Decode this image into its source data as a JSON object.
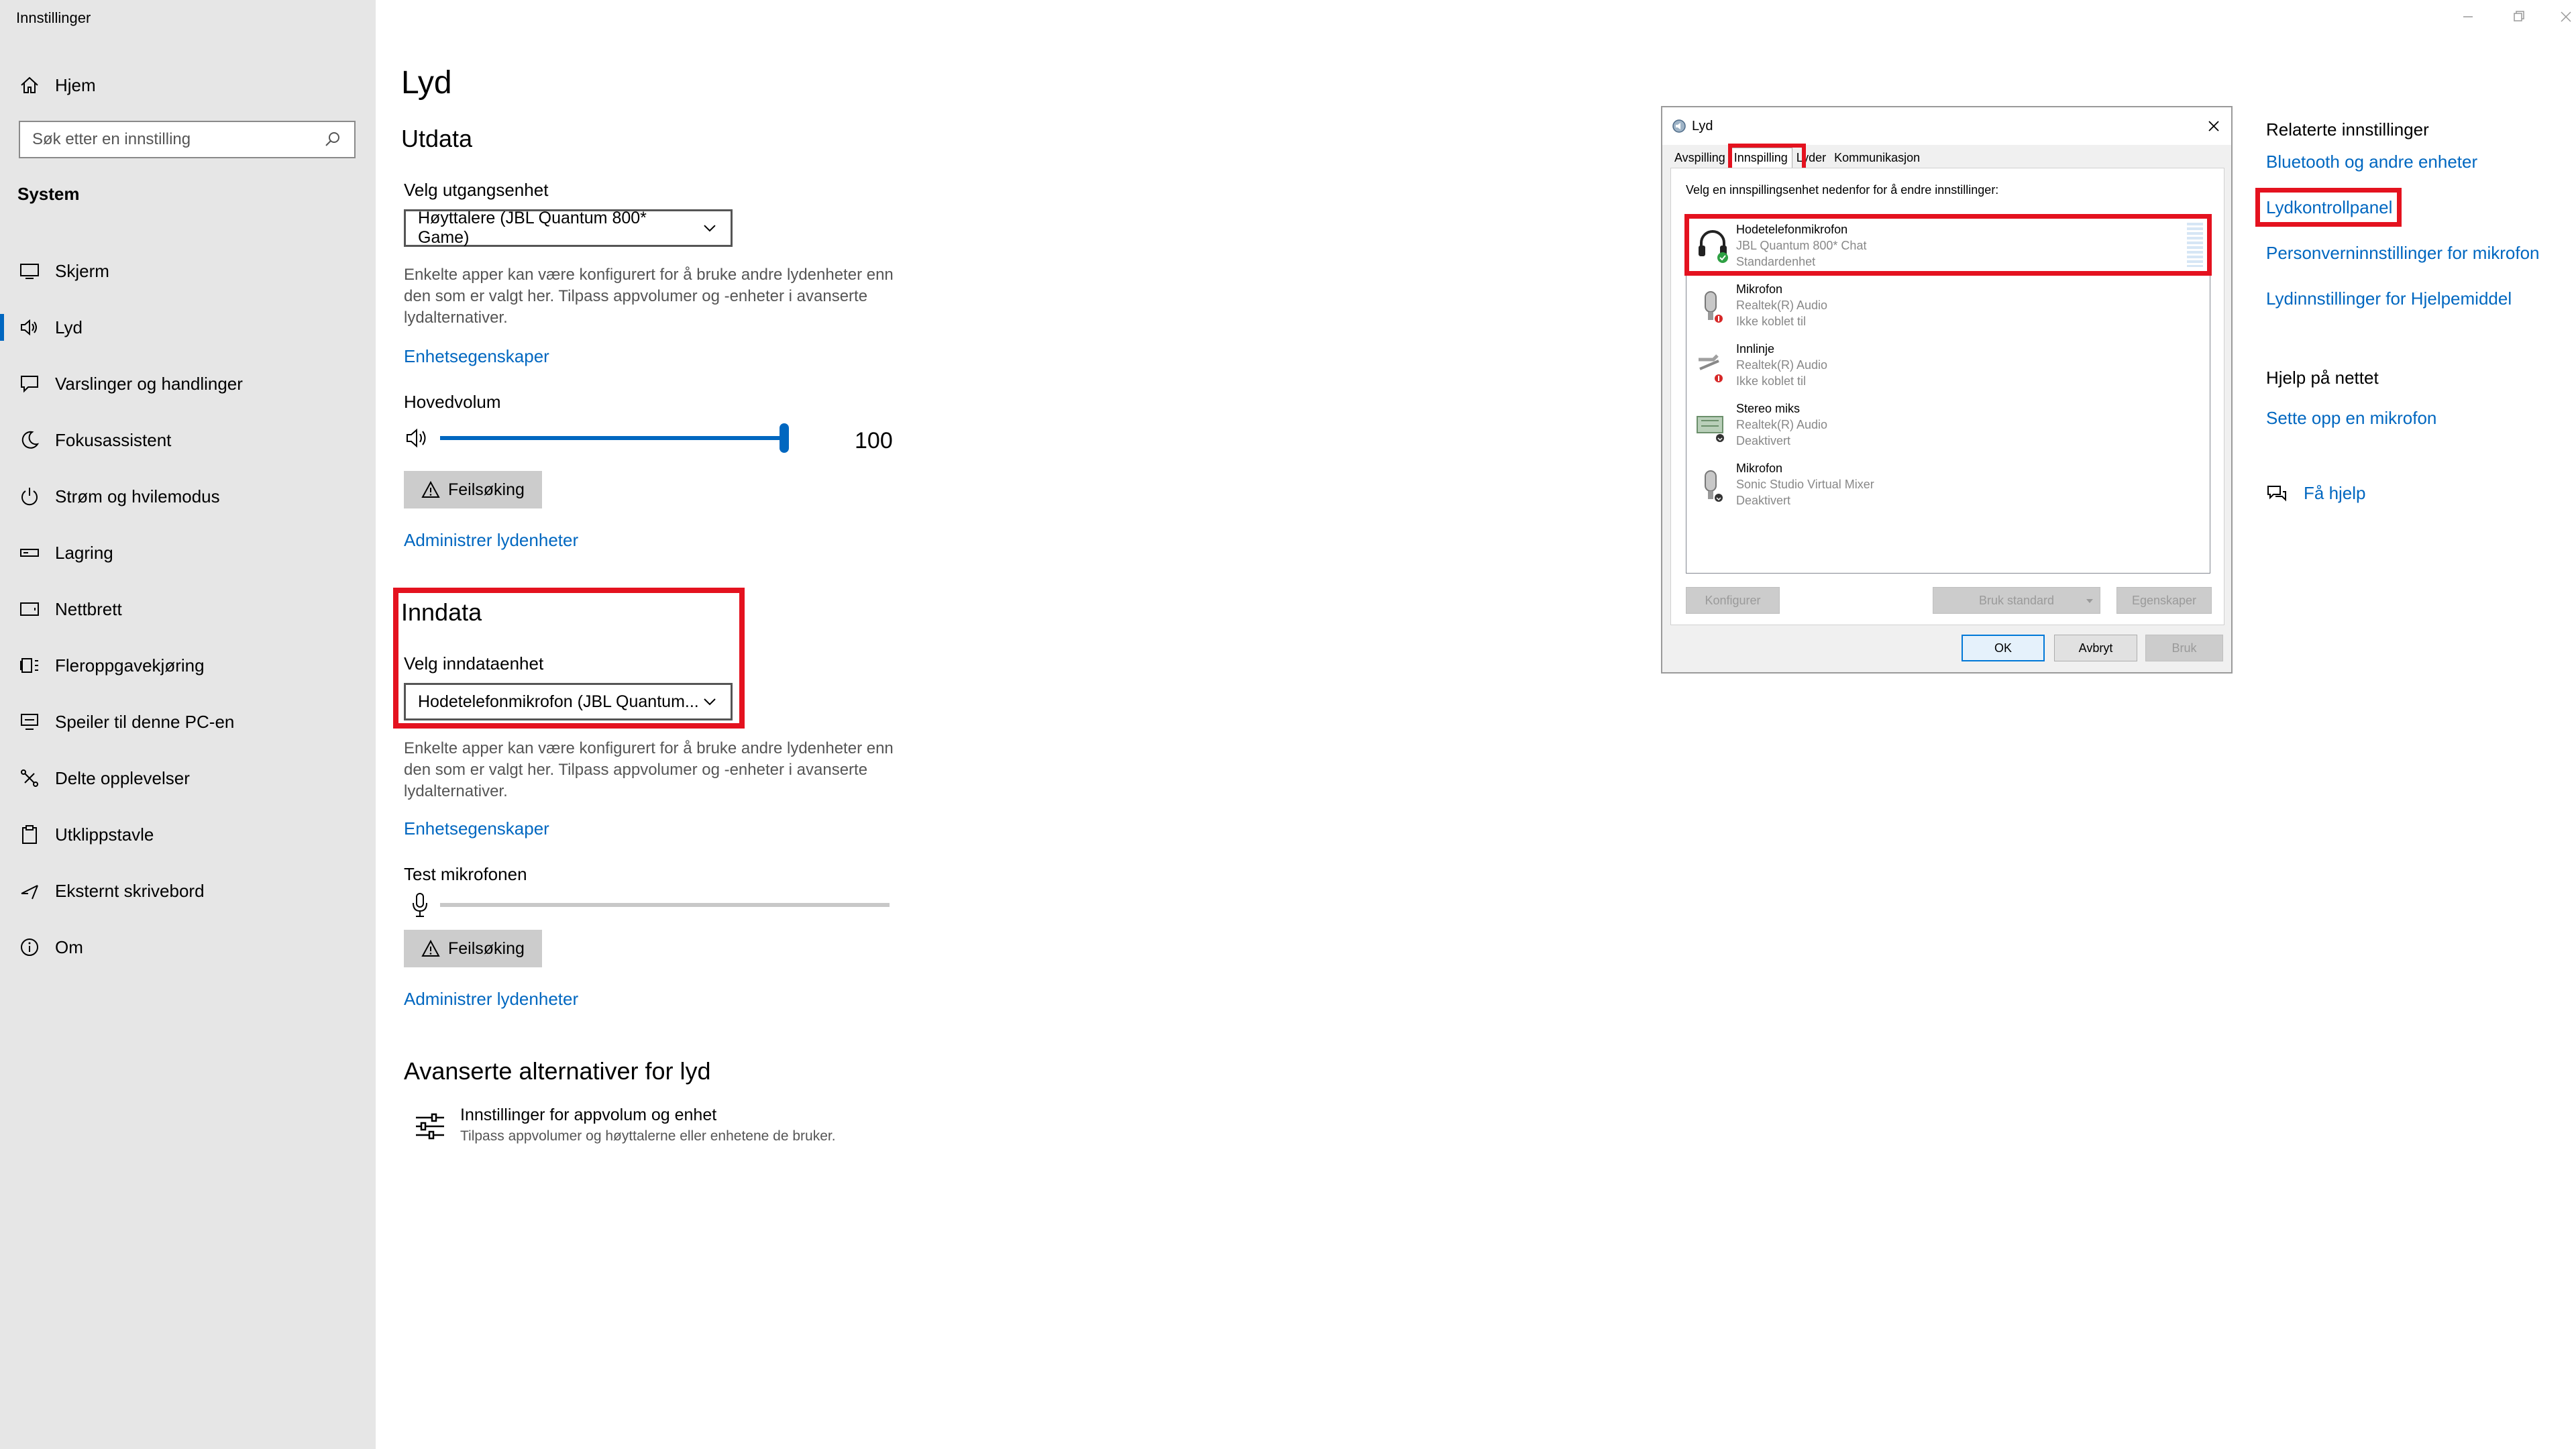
{
  "app_title": "Innstillinger",
  "nav": {
    "home_label": "Hjem",
    "search_placeholder": "Søk etter en innstilling",
    "section": "System",
    "items": [
      {
        "label": "Skjerm",
        "icon": "monitor-icon"
      },
      {
        "label": "Lyd",
        "icon": "speaker-icon",
        "active": true
      },
      {
        "label": "Varslinger og handlinger",
        "icon": "notification-icon"
      },
      {
        "label": "Fokusassistent",
        "icon": "moon-icon"
      },
      {
        "label": "Strøm og hvilemodus",
        "icon": "power-icon"
      },
      {
        "label": "Lagring",
        "icon": "storage-icon"
      },
      {
        "label": "Nettbrett",
        "icon": "tablet-icon"
      },
      {
        "label": "Fleroppgavekjøring",
        "icon": "multitasking-icon"
      },
      {
        "label": "Speiler til denne PC-en",
        "icon": "projecting-icon"
      },
      {
        "label": "Delte opplevelser",
        "icon": "shared-experiences-icon"
      },
      {
        "label": "Utklippstavle",
        "icon": "clipboard-icon"
      },
      {
        "label": "Eksternt skrivebord",
        "icon": "remote-desktop-icon"
      },
      {
        "label": "Om",
        "icon": "info-icon"
      }
    ]
  },
  "main": {
    "title": "Lyd",
    "output": {
      "heading": "Utdata",
      "select_label": "Velg utgangsenhet",
      "device": "Høyttalere (JBL Quantum 800* Game)",
      "note_lines": [
        "Enkelte apper kan være konfigurert for å bruke andre lydenheter enn",
        "den som er valgt her. Tilpass appvolumer og -enheter i avanserte",
        "lydalternativer."
      ],
      "device_props_link": "Enhetsegenskaper",
      "volume_label": "Hovedvolum",
      "volume_value": "100",
      "volume_fraction": 1.0,
      "troubleshoot": "Feilsøking",
      "manage_link": "Administrer lydenheter"
    },
    "input": {
      "heading": "Inndata",
      "select_label": "Velg inndataenhet",
      "device": "Hodetelefonmikrofon (JBL Quantum...",
      "note_lines": [
        "Enkelte apper kan være konfigurert for å bruke andre lydenheter enn",
        "den som er valgt her. Tilpass appvolumer og -enheter i avanserte",
        "lydalternativer."
      ],
      "device_props_link": "Enhetsegenskaper",
      "test_label": "Test mikrofonen",
      "troubleshoot": "Feilsøking",
      "manage_link": "Administrer lydenheter"
    },
    "advanced": {
      "heading": "Avanserte alternativer for lyd",
      "item_title": "Innstillinger for appvolum og enhet",
      "item_desc": "Tilpass appvolumer og høyttalerne eller enhetene de bruker."
    }
  },
  "dialog": {
    "title": "Lyd",
    "tabs": [
      "Avspilling",
      "Innspilling",
      "Lyder",
      "Kommunikasjon"
    ],
    "active_tab": "Innspilling",
    "instruction": "Velg en innspillingsenhet nedenfor for å endre innstillinger:",
    "devices": [
      {
        "name": "Hodetelefonmikrofon",
        "driver": "JBL Quantum 800* Chat",
        "status": "Standardenhet",
        "icon": "headset-mic-icon"
      },
      {
        "name": "Mikrofon",
        "driver": "Realtek(R) Audio",
        "status": "Ikke koblet til",
        "icon": "microphone-icon"
      },
      {
        "name": "Innlinje",
        "driver": "Realtek(R) Audio",
        "status": "Ikke koblet til",
        "icon": "line-in-icon"
      },
      {
        "name": "Stereo miks",
        "driver": "Realtek(R) Audio",
        "status": "Deaktivert",
        "icon": "circuit-board-icon"
      },
      {
        "name": "Mikrofon",
        "driver": "Sonic Studio Virtual Mixer",
        "status": "Deaktivert",
        "icon": "microphone-icon"
      }
    ],
    "buttons": {
      "configure": "Konfigurer",
      "set_default": "Bruk standard",
      "properties": "Egenskaper",
      "ok": "OK",
      "cancel": "Avbryt",
      "apply": "Bruk"
    }
  },
  "related": {
    "heading": "Relaterte innstillinger",
    "links": [
      "Bluetooth og andre enheter",
      "Lydkontrollpanel",
      "Personverninnstillinger for mikrofon",
      "Lydinnstillinger for Hjelpemiddel"
    ],
    "help_heading": "Hjelp på nettet",
    "help_link": "Sette opp en mikrofon",
    "get_help": "Få hjelp"
  },
  "colors": {
    "accent": "#0067c0",
    "highlight": "#e4121f",
    "sidebar": "#e6e6e6"
  }
}
